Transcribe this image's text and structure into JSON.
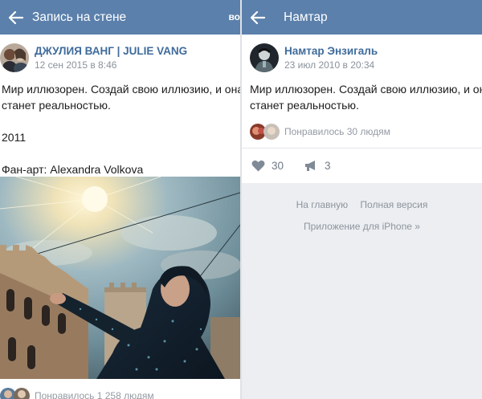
{
  "left": {
    "topbar": {
      "title": "Запись на стене",
      "extra": "во"
    },
    "post": {
      "author": "ДЖУЛИЯ ВАНГ | JULIE VANG",
      "date": "12 сен 2015 в 8:46",
      "lines": [
        "Мир иллюзорен. Создай свою иллюзию, и она",
        "станет реальностью.",
        "",
        "2011",
        "",
        "Фан-арт: Alexandra Volkova"
      ]
    },
    "likes_text": "Понравилось 1 258 людям"
  },
  "right": {
    "topbar": {
      "title": "Намтар"
    },
    "post": {
      "author": "Намтар Энзигаль",
      "date": "23 июл 2010 в 20:34",
      "lines": [
        "Мир иллюзорен. Создай свою иллюзию, и она",
        "станет реальностью."
      ]
    },
    "likes_text": "Понравилось 30 людям",
    "actions": {
      "likes": "30",
      "reposts": "3"
    },
    "footer": {
      "home": "На главную",
      "full": "Полная версия",
      "app": "Приложение для iPhone »"
    }
  },
  "colors": {
    "topbar": "#5b80ab",
    "author": "#3f6b9c",
    "muted": "#8a929c"
  }
}
